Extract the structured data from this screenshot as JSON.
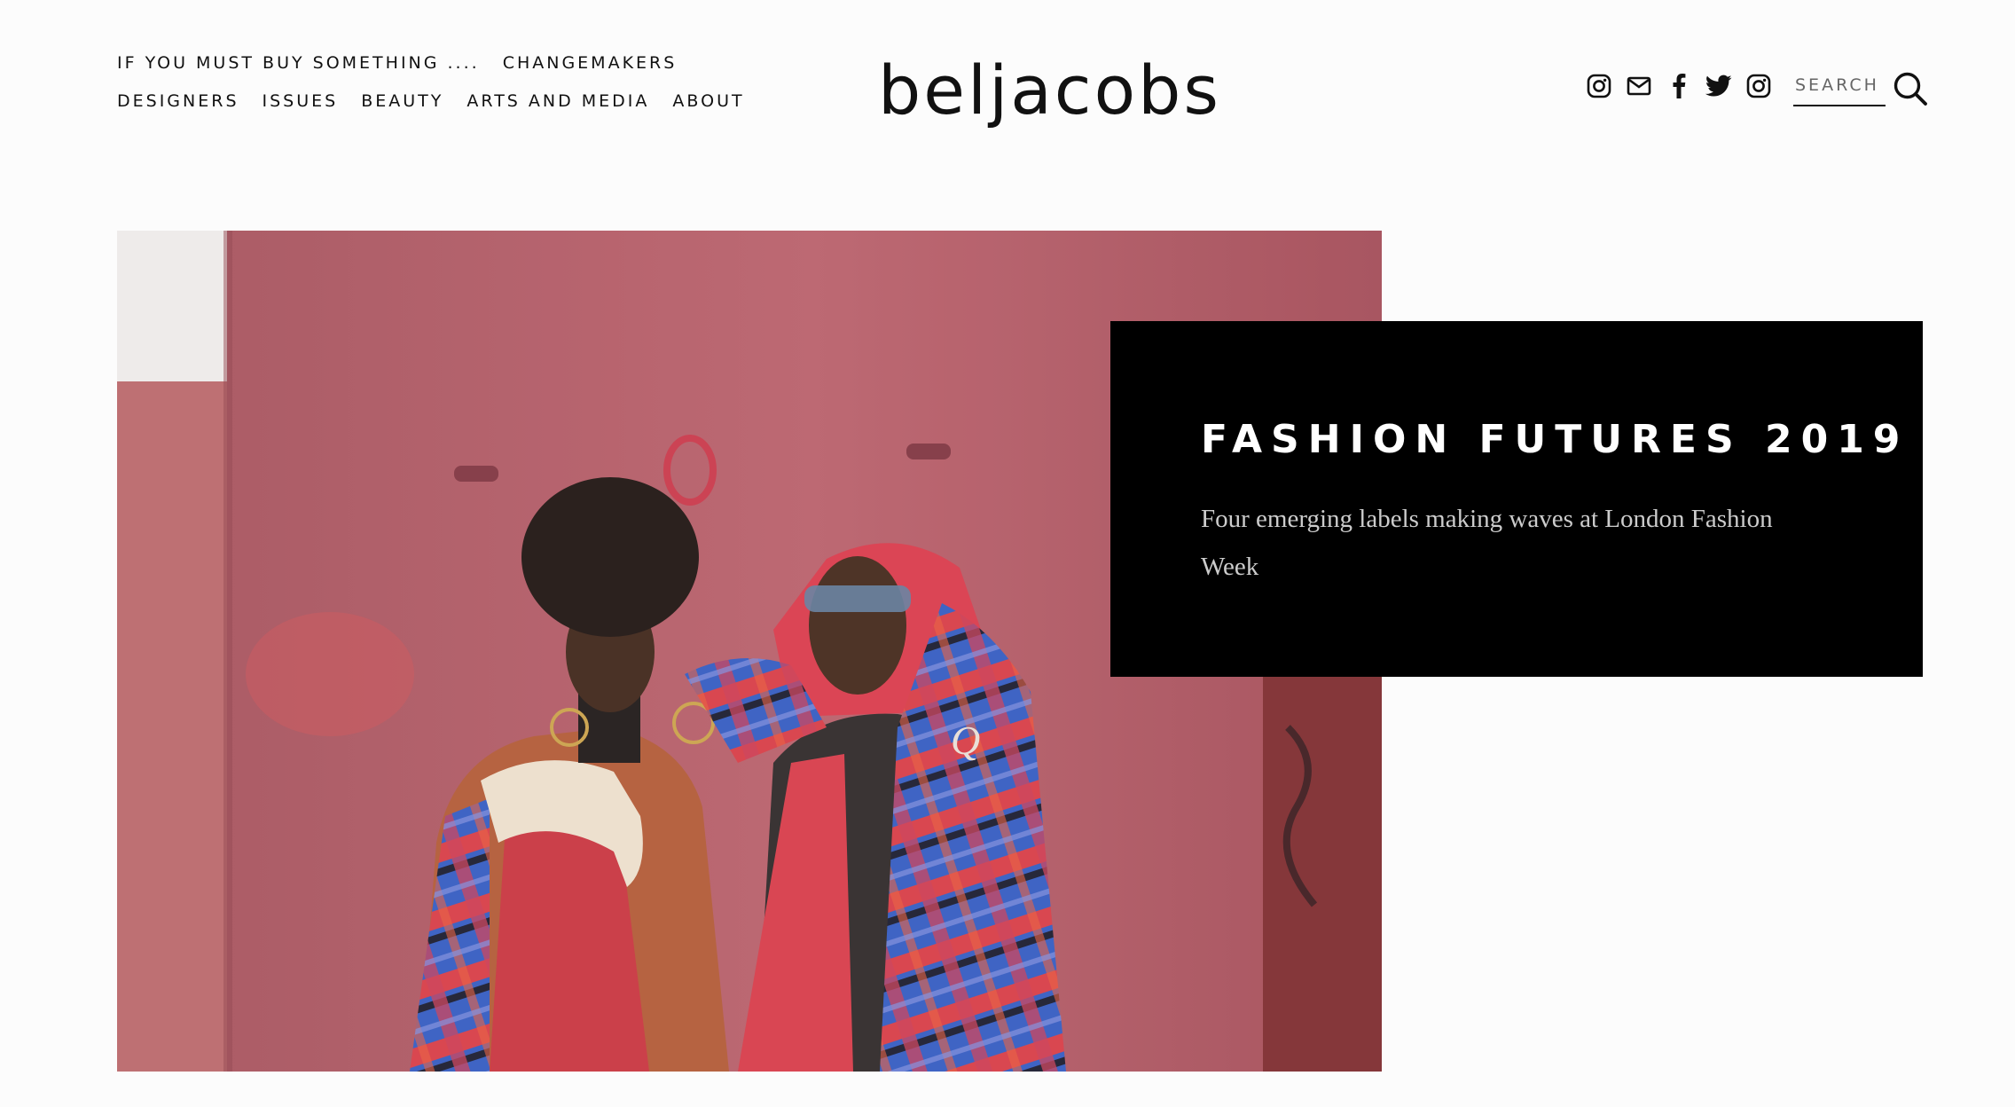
{
  "header": {
    "logo": "beljacobs",
    "nav_row1": [
      "IF YOU MUST BUY SOMETHING ....",
      "CHANGEMAKERS"
    ],
    "nav_row2": [
      "DESIGNERS",
      "ISSUES",
      "BEAUTY",
      "ARTS AND MEDIA",
      "ABOUT"
    ],
    "social": [
      "instagram-icon",
      "mail-icon",
      "facebook-icon",
      "twitter-icon",
      "instagram-icon"
    ],
    "search": {
      "placeholder": "SEARCH",
      "icon": "search-icon"
    }
  },
  "feature": {
    "title": "FASHION FUTURES 2019",
    "subtitle": "Four emerging labels making waves at London Fashion Week",
    "image": "photo-two-models-plaid-blanket"
  },
  "colors": {
    "background": "#fcfcfc",
    "text": "#111111",
    "card_bg": "#000000",
    "card_title": "#ffffff",
    "card_subtitle": "#cccccc",
    "wall": "#b15a68"
  }
}
